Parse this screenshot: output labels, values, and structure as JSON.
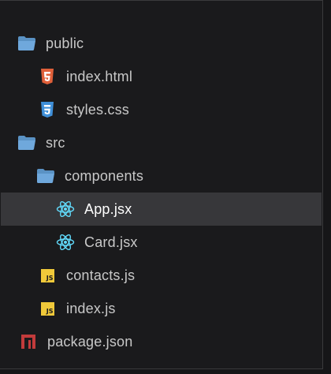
{
  "colors": {
    "folder": "#6fa8dc",
    "html5": "#e0603a",
    "css3": "#3f8fd8",
    "react": "#61dafb",
    "js": "#f0c93a",
    "npm": "#c23b3b",
    "selected_row": "#37373a"
  },
  "tree": [
    {
      "label": "public",
      "icon": "folder-open-icon"
    },
    {
      "label": "index.html",
      "icon": "html5-icon"
    },
    {
      "label": "styles.css",
      "icon": "css3-icon"
    },
    {
      "label": "src",
      "icon": "folder-open-icon"
    },
    {
      "label": "components",
      "icon": "folder-open-icon"
    },
    {
      "label": "App.jsx",
      "icon": "react-icon",
      "selected": true
    },
    {
      "label": "Card.jsx",
      "icon": "react-icon"
    },
    {
      "label": "contacts.js",
      "icon": "js-icon",
      "badge": "JS"
    },
    {
      "label": "index.js",
      "icon": "js-icon",
      "badge": "JS"
    },
    {
      "label": "package.json",
      "icon": "npm-icon"
    }
  ]
}
